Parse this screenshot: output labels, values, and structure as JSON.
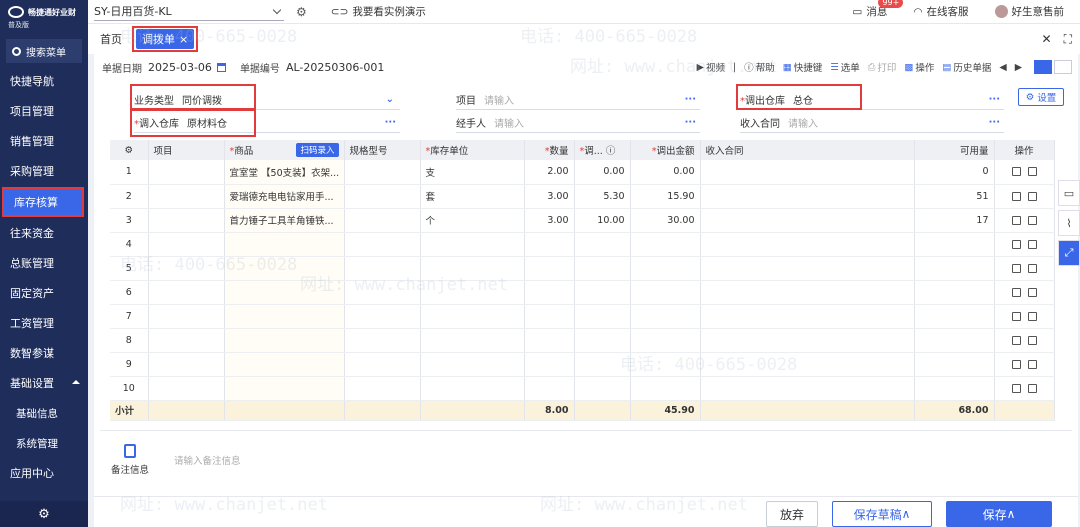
{
  "sidebar": {
    "brand_name": "畅捷通好业财",
    "brand_edition": "普及版",
    "search_label": "搜索菜单",
    "items": [
      {
        "label": "快捷导航"
      },
      {
        "label": "项目管理"
      },
      {
        "label": "销售管理"
      },
      {
        "label": "采购管理"
      },
      {
        "label": "库存核算"
      },
      {
        "label": "往来资金"
      },
      {
        "label": "总账管理"
      },
      {
        "label": "固定资产"
      },
      {
        "label": "工资管理"
      },
      {
        "label": "数智参谋"
      },
      {
        "label": "基础设置"
      },
      {
        "label": "基础信息"
      },
      {
        "label": "系统管理"
      },
      {
        "label": "应用中心"
      }
    ]
  },
  "header": {
    "account": "SY-日用百货-KL",
    "demo_link": "我要看实例演示",
    "messages_label": "消息",
    "messages_badge": "99+",
    "service_label": "在线客服",
    "user_label": "好生意售前"
  },
  "tabs": {
    "home": "首页",
    "active": "调拨单"
  },
  "meta": {
    "date_label": "单据日期",
    "date_value": "2025-03-06",
    "code_label": "单据编号",
    "code_value": "AL-20250306-001"
  },
  "toolbar": {
    "video": "视频",
    "help": "帮助",
    "shortcut": "快捷键",
    "select": "选单",
    "print": "打印",
    "operate": "操作",
    "history": "历史单据"
  },
  "form": {
    "biz_type_label": "业务类型",
    "biz_type_value": "同价调拨",
    "project_label": "项目",
    "project_placeholder": "请输入",
    "out_wh_label": "调出仓库",
    "out_wh_value": "总仓",
    "settings": "设置",
    "in_wh_label": "调入仓库",
    "in_wh_value": "原材料仓",
    "handler_label": "经手人",
    "handler_placeholder": "请输入",
    "contract_label": "收入合同",
    "contract_placeholder": "请输入"
  },
  "grid": {
    "columns": {
      "project": "项目",
      "product": "商品",
      "scan": "扫码录入",
      "spec": "规格型号",
      "unit": "库存单位",
      "qty": "数量",
      "price": "调...",
      "amount": "调出金额",
      "contract": "收入合同",
      "available": "可用量",
      "ops": "操作"
    },
    "rows": [
      {
        "no": "1",
        "product": "宜室堂 【50支装】衣架...",
        "unit": "支",
        "qty": "2.00",
        "price": "0.00",
        "amount": "0.00",
        "available": "0"
      },
      {
        "no": "2",
        "product": "爱瑞德充电电钻家用手...",
        "unit": "套",
        "qty": "3.00",
        "price": "5.30",
        "amount": "15.90",
        "available": "51"
      },
      {
        "no": "3",
        "product": "首力锤子工具羊角锤铁...",
        "unit": "个",
        "qty": "3.00",
        "price": "10.00",
        "amount": "30.00",
        "available": "17"
      },
      {
        "no": "4",
        "product": "",
        "unit": "",
        "qty": "",
        "price": "",
        "amount": "",
        "available": ""
      },
      {
        "no": "5",
        "product": "",
        "unit": "",
        "qty": "",
        "price": "",
        "amount": "",
        "available": ""
      },
      {
        "no": "6",
        "product": "",
        "unit": "",
        "qty": "",
        "price": "",
        "amount": "",
        "available": ""
      },
      {
        "no": "7",
        "product": "",
        "unit": "",
        "qty": "",
        "price": "",
        "amount": "",
        "available": ""
      },
      {
        "no": "8",
        "product": "",
        "unit": "",
        "qty": "",
        "price": "",
        "amount": "",
        "available": ""
      },
      {
        "no": "9",
        "product": "",
        "unit": "",
        "qty": "",
        "price": "",
        "amount": "",
        "available": ""
      },
      {
        "no": "10",
        "product": "",
        "unit": "",
        "qty": "",
        "price": "",
        "amount": "",
        "available": ""
      }
    ],
    "subtotal": {
      "label": "小计",
      "qty": "8.00",
      "amount": "45.90",
      "available": "68.00"
    }
  },
  "note": {
    "label": "备注信息",
    "placeholder": "请输入备注信息"
  },
  "footer": {
    "discard": "放弃",
    "draft": "保存草稿",
    "save": "保存"
  },
  "watermark": {
    "phone": "电话: 400-665-0028",
    "site": "网址: www.chanjet.net"
  },
  "colors": {
    "sidebar_bg": "#1f2d5a",
    "accent": "#3a67e8",
    "highlight_border": "#e23b3b",
    "subtotal_bg": "#fbf2dc"
  }
}
